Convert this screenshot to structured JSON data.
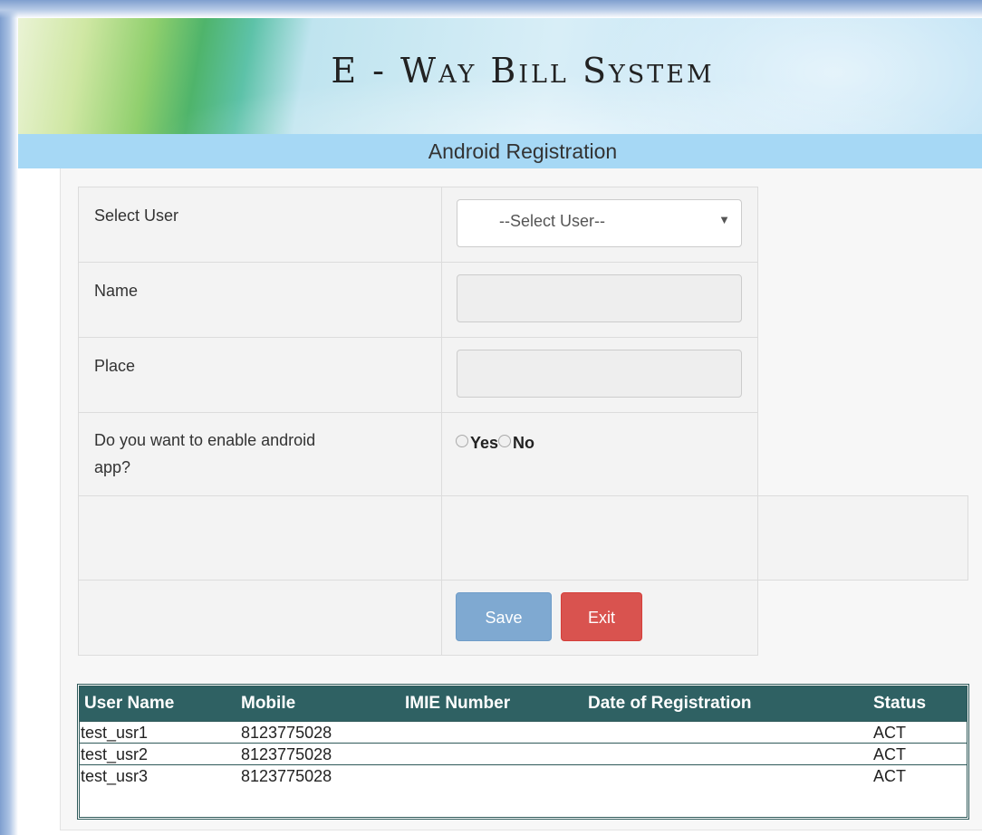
{
  "header": {
    "title": "E - Way Bill System",
    "subtitle": "Android Registration"
  },
  "form": {
    "select_user_label": "Select User",
    "select_user_value": "--Select User--",
    "name_label": "Name",
    "name_value": "",
    "place_label": "Place",
    "place_value": "",
    "enable_question_line1": "Do you want to enable android",
    "enable_question_line2": "app?",
    "radio_yes": "Yes",
    "radio_no": "No",
    "selected_option": "",
    "save_label": "Save",
    "exit_label": "Exit"
  },
  "table": {
    "columns": [
      "User Name",
      "Mobile",
      "IMIE Number",
      "Date of Registration",
      "Status"
    ],
    "rows": [
      [
        "test_usr1",
        "8123775028",
        "",
        "",
        "ACT"
      ],
      [
        "test_usr2",
        "8123775028",
        "",
        "",
        "ACT"
      ],
      [
        "test_usr3",
        "8123775028",
        "",
        "",
        "ACT"
      ]
    ]
  },
  "colors": {
    "header_bar": "#a6d8f5",
    "grid_header": "#2f6163",
    "save_button": "#7fa9d1",
    "exit_button": "#d9534f"
  },
  "icons": {
    "select_arrow": "caret-down-icon"
  }
}
